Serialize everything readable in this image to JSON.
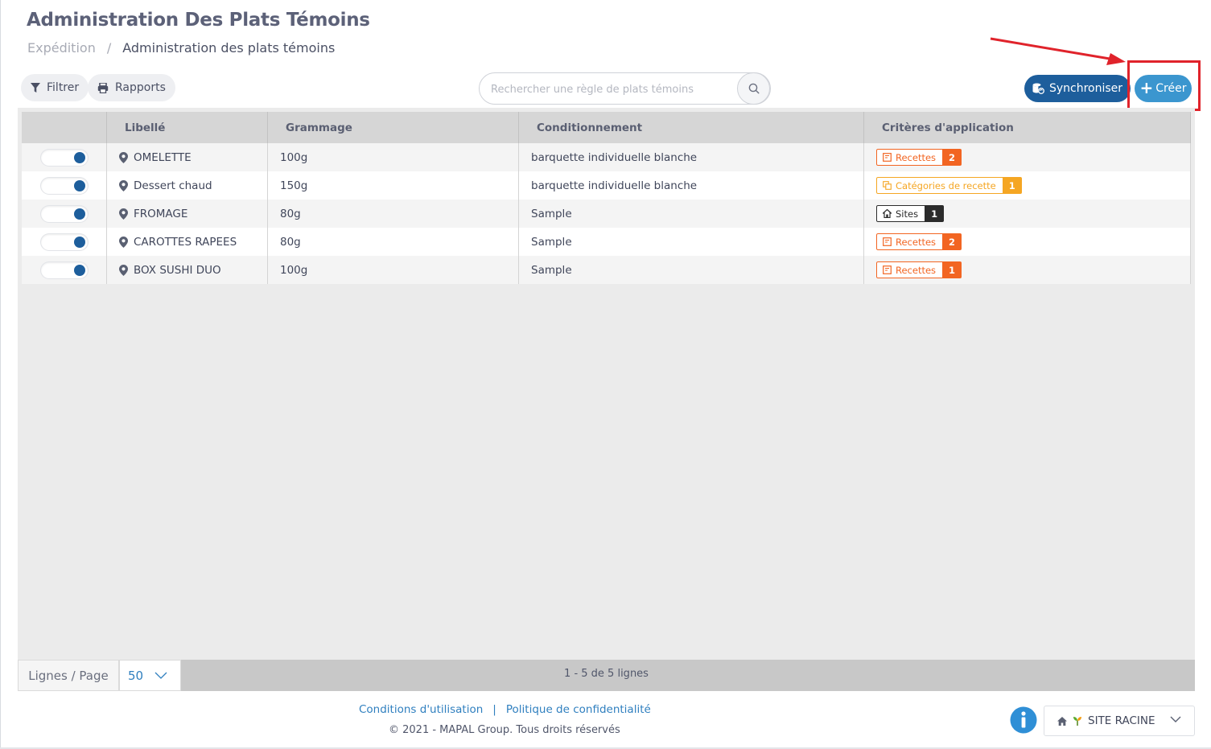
{
  "page": {
    "title": "Administration Des Plats Témoins",
    "breadcrumb": {
      "parent": "Expédition",
      "separator": "/",
      "current": "Administration des plats témoins"
    }
  },
  "toolbar": {
    "filter_label": "Filtrer",
    "reports_label": "Rapports",
    "search_placeholder": "Rechercher une règle de plats témoins",
    "sync_label": "Synchroniser",
    "create_label": "Créer"
  },
  "table": {
    "headers": [
      "",
      "Libellé",
      "Grammage",
      "Conditionnement",
      "Critères d'application"
    ],
    "rows": [
      {
        "active": true,
        "label": "OMELETTE",
        "grammage": "100g",
        "packaging": "barquette individuelle blanche",
        "criteria": {
          "label": "Recettes",
          "count": "2",
          "kind": "recipes"
        }
      },
      {
        "active": true,
        "label": "Dessert chaud",
        "grammage": "150g",
        "packaging": "barquette individuelle blanche",
        "criteria": {
          "label": "Catégories de recette",
          "count": "1",
          "kind": "categories"
        }
      },
      {
        "active": true,
        "label": "FROMAGE",
        "grammage": "80g",
        "packaging": "Sample",
        "criteria": {
          "label": "Sites",
          "count": "1",
          "kind": "sites"
        }
      },
      {
        "active": true,
        "label": "CAROTTES RAPEES",
        "grammage": "80g",
        "packaging": "Sample",
        "criteria": {
          "label": "Recettes",
          "count": "2",
          "kind": "recipes"
        }
      },
      {
        "active": true,
        "label": "BOX SUSHI DUO",
        "grammage": "100g",
        "packaging": "Sample",
        "criteria": {
          "label": "Recettes",
          "count": "1",
          "kind": "recipes"
        }
      }
    ]
  },
  "pager": {
    "lines_per_page_label": "Lignes / Page",
    "per_page_value": "50",
    "info": "1 - 5 de 5 lignes"
  },
  "footer": {
    "terms_link": "Conditions d'utilisation",
    "separator": "|",
    "privacy_link": "Politique de confidentialité",
    "copyright": "© 2021 - MAPAL Group. Tous droits réservés"
  },
  "site_selector": {
    "value": "SITE RACINE"
  },
  "icons": {
    "filter": "filter-icon",
    "print": "printer-icon",
    "search": "search-icon",
    "sync": "database-sync-icon",
    "create": "plus-icon",
    "location": "map-pin-icon",
    "recipes": "recipe-book-icon",
    "categories": "copy-icon",
    "sites": "house-icon",
    "info": "info-icon",
    "site": "home-icon",
    "chevron": "chevron-down-icon"
  },
  "colors": {
    "primary": "#1d5e9c",
    "create": "#3b96cf",
    "recipes_badge": "#f26522",
    "categories_badge": "#f5a623",
    "sites_badge": "#2b2b2b",
    "annotation": "#e0232b",
    "link": "#2f7fbf"
  }
}
